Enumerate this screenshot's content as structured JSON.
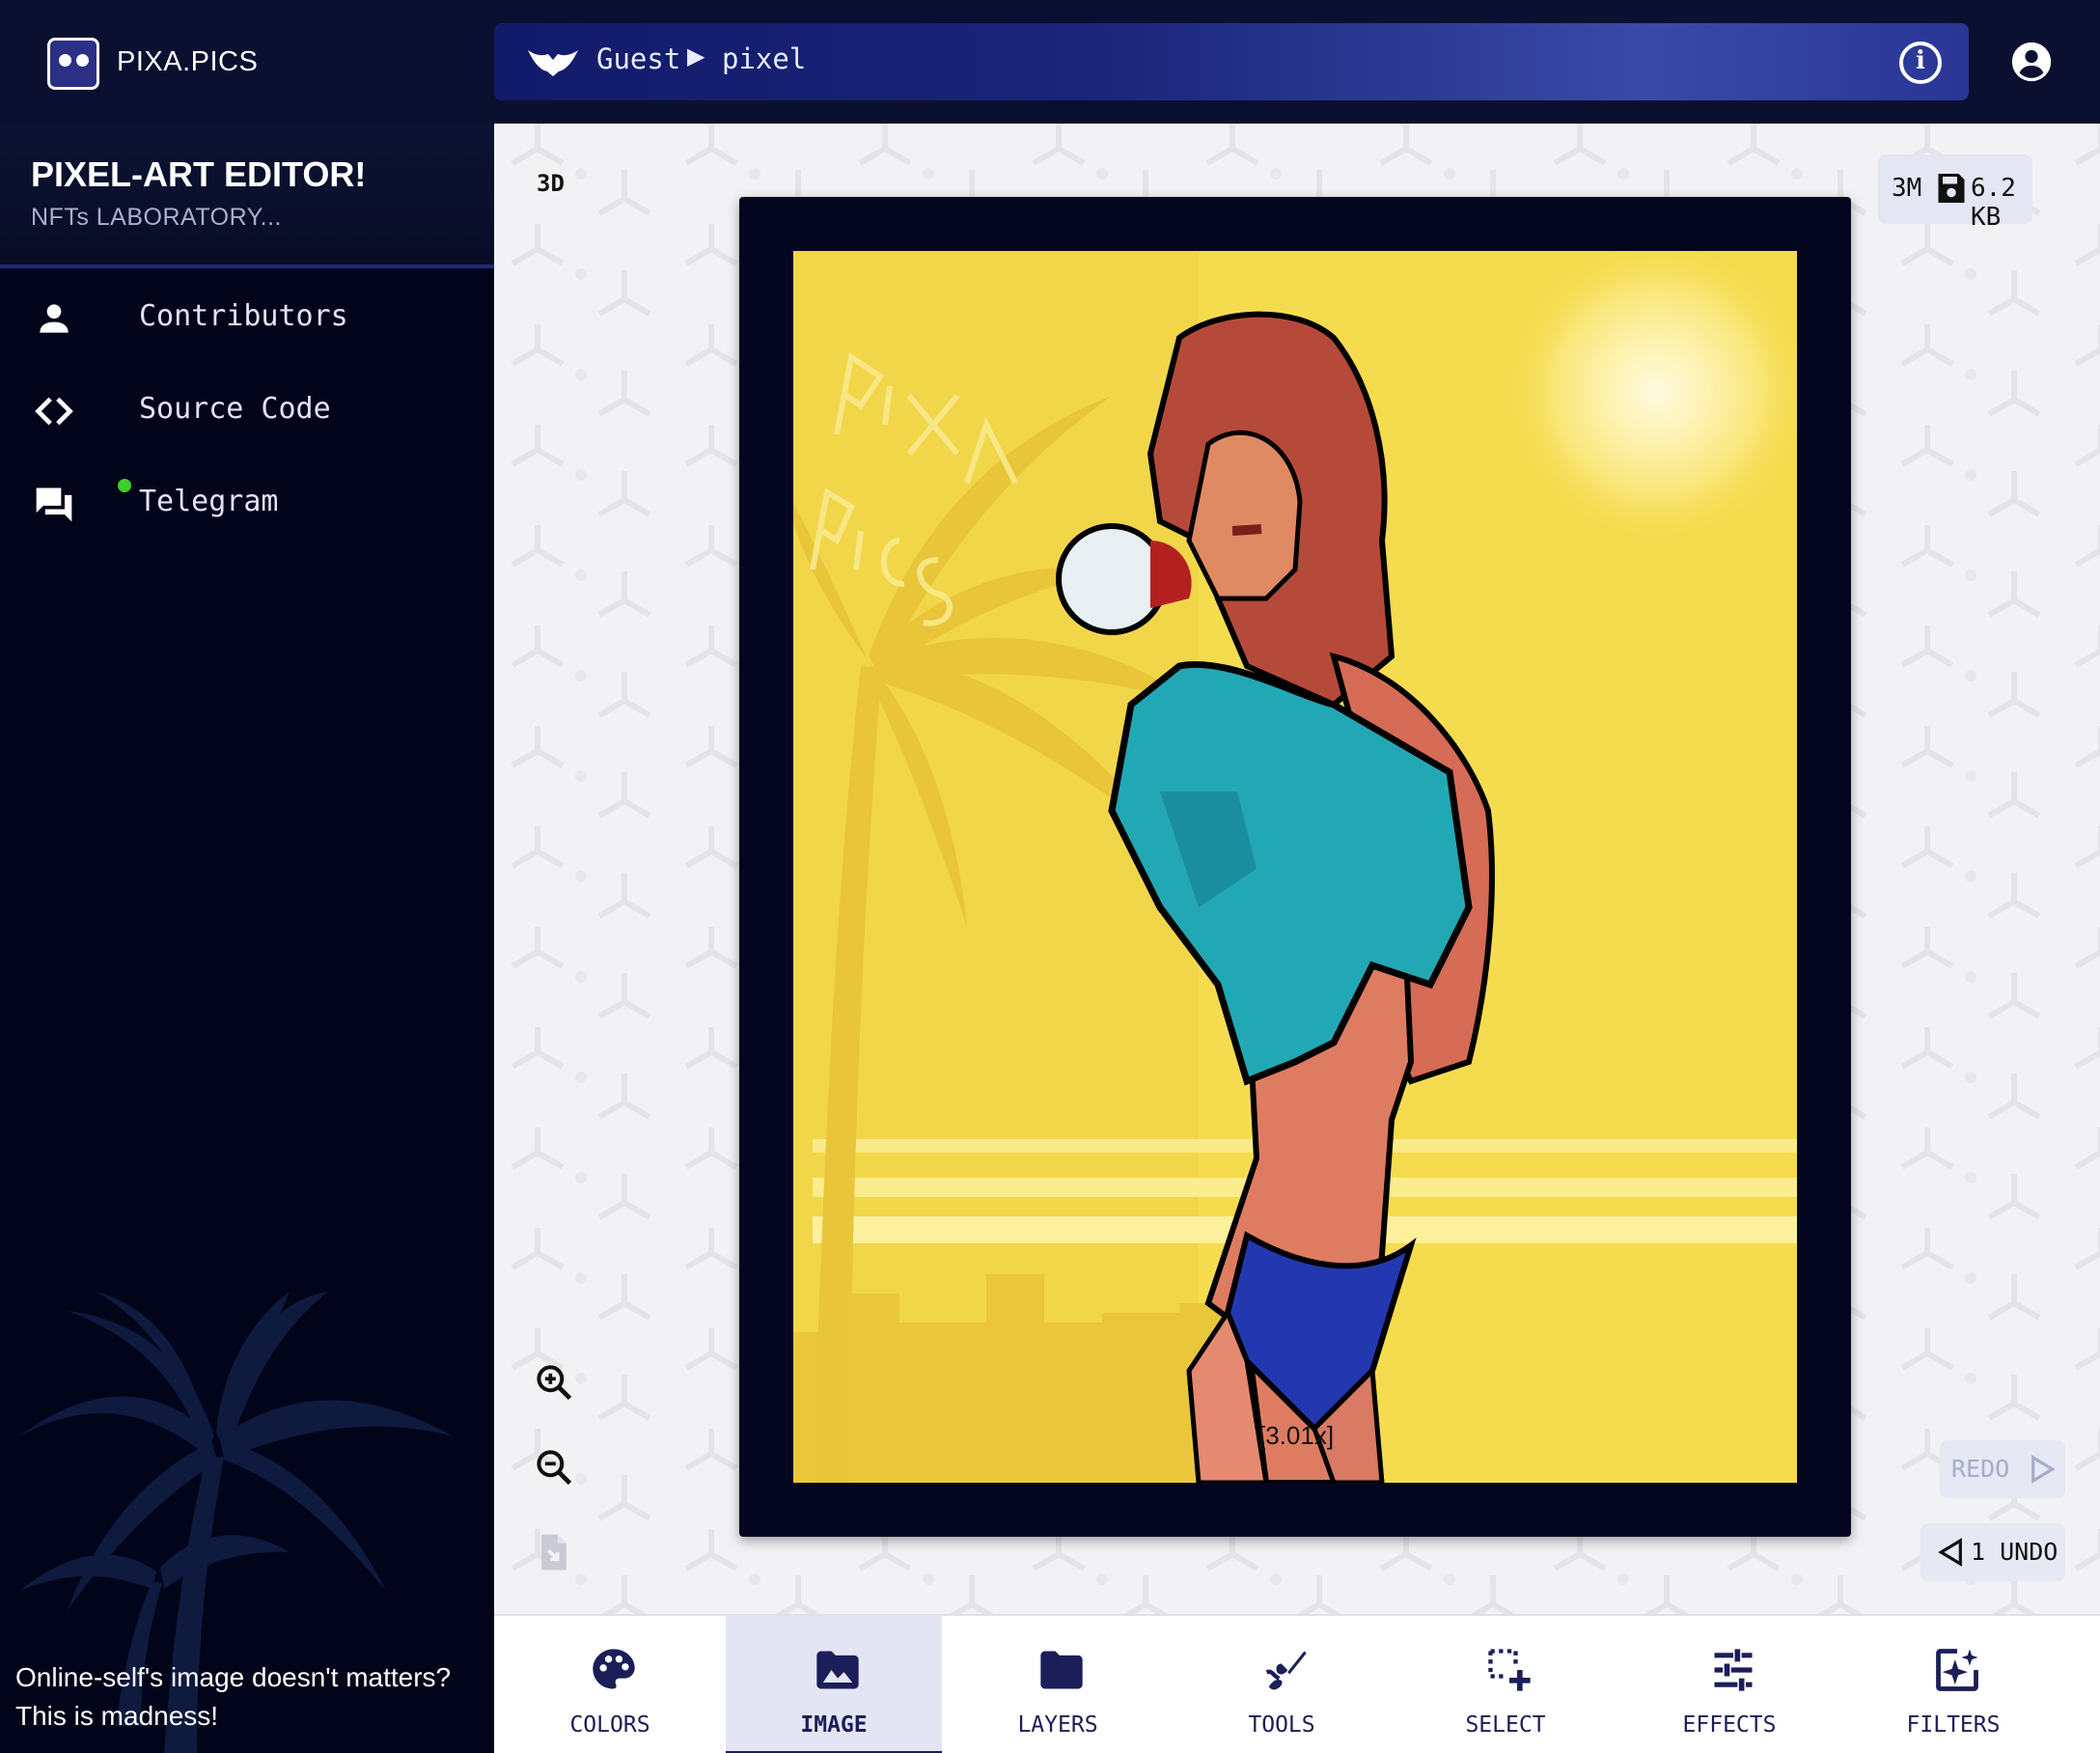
{
  "app": {
    "brand": "PIXA.PICS"
  },
  "breadcrumb": {
    "user": "Guest",
    "separator": "▶",
    "page": "pixel"
  },
  "sidebar": {
    "title": "PIXEL-ART EDITOR!",
    "subtitle": "NFTs LABORATORY...",
    "items": [
      {
        "label": "Contributors",
        "icon": "person-icon"
      },
      {
        "label": "Source Code",
        "icon": "code-icon"
      },
      {
        "label": "Telegram",
        "icon": "forum-icon",
        "online": true
      }
    ],
    "quote_line1": "Online-self's image doesn't matters?",
    "quote_line2": "This is madness!"
  },
  "canvas": {
    "mode_3d_label": "3D",
    "resolution": "3M",
    "file_size": "6.2 KB",
    "zoom": "[3.01x]",
    "redo_label": "REDO",
    "undo_label": "1 UNDO"
  },
  "bottom_tabs": [
    {
      "label": "COLORS",
      "icon": "palette-icon",
      "active": false
    },
    {
      "label": "IMAGE",
      "icon": "image-icon",
      "active": true
    },
    {
      "label": "LAYERS",
      "icon": "folder-icon",
      "active": false
    },
    {
      "label": "TOOLS",
      "icon": "brush-icon",
      "active": false
    },
    {
      "label": "SELECT",
      "icon": "select-icon",
      "active": false
    },
    {
      "label": "EFFECTS",
      "icon": "tune-icon",
      "active": false
    },
    {
      "label": "FILTERS",
      "icon": "sparkle-icon",
      "active": false
    }
  ],
  "colors": {
    "topbar": "#0b1030",
    "sidebar": "#02051a",
    "accent": "#1b1e58",
    "artwork_background": "#f4d84a",
    "frame": "#04051f",
    "online_dot": "#3ccf28"
  }
}
